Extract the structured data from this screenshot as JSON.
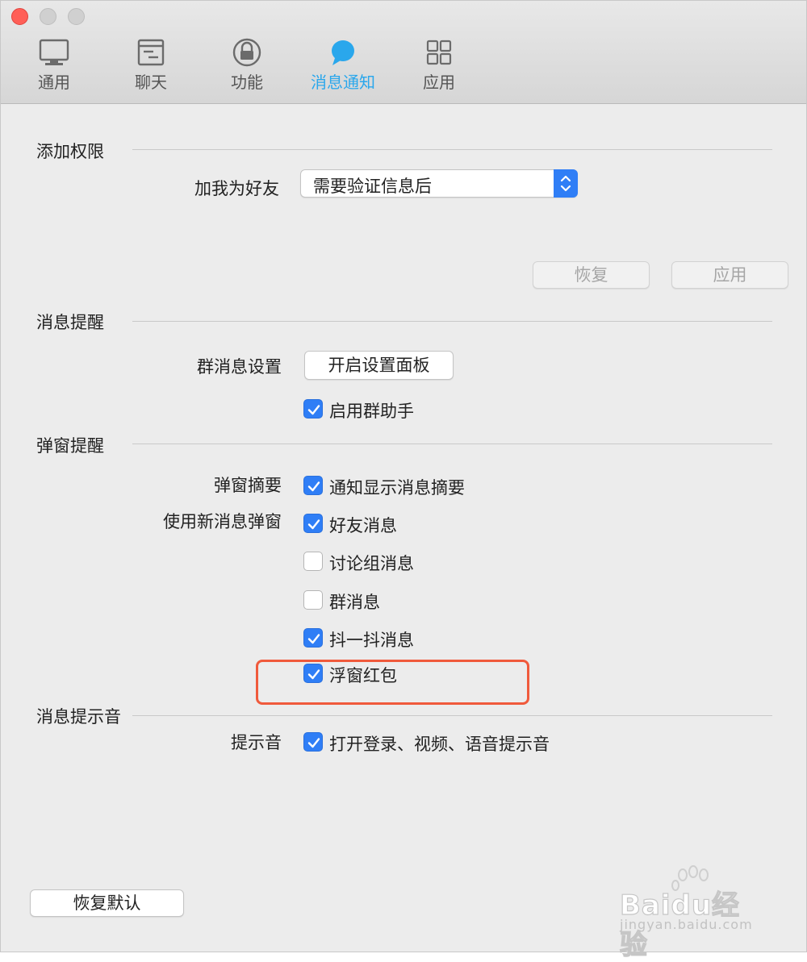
{
  "tabs": [
    {
      "label": "通用",
      "icon": "monitor-icon",
      "active": false
    },
    {
      "label": "聊天",
      "icon": "chat-window-icon",
      "active": false
    },
    {
      "label": "功能",
      "icon": "lock-icon",
      "active": false
    },
    {
      "label": "消息通知",
      "icon": "speech-bubble-icon",
      "active": true
    },
    {
      "label": "应用",
      "icon": "grid-icon",
      "active": false
    }
  ],
  "permissions": {
    "title": "添加权限",
    "add_friend_label": "加我为好友",
    "add_friend_value": "需要验证信息后",
    "restore_button": "恢复",
    "apply_button": "应用"
  },
  "reminder": {
    "title": "消息提醒",
    "group_settings_label": "群消息设置",
    "open_panel_button": "开启设置面板",
    "enable_group_helper": {
      "label": "启用群助手",
      "checked": true
    }
  },
  "popup": {
    "title": "弹窗提醒",
    "summary_label": "弹窗摘要",
    "summary_option": {
      "label": "通知显示消息摘要",
      "checked": true
    },
    "new_popup_label": "使用新消息弹窗",
    "options": [
      {
        "label": "好友消息",
        "checked": true
      },
      {
        "label": "讨论组消息",
        "checked": false
      },
      {
        "label": "群消息",
        "checked": false
      },
      {
        "label": "抖一抖消息",
        "checked": true
      },
      {
        "label": "浮窗红包",
        "checked": true
      }
    ]
  },
  "sound": {
    "title": "消息提示音",
    "tone_label": "提示音",
    "tone_option": {
      "label": "打开登录、视频、语音提示音",
      "checked": true
    }
  },
  "footer": {
    "restore_default_button": "恢复默认"
  },
  "watermark": {
    "brand": "Baidu经验",
    "url": "jingyan.baidu.com"
  },
  "colors": {
    "accent": "#2aa7ec",
    "checkbox": "#2f7ef6",
    "highlight": "#f05a3c",
    "close": "#ff5f57"
  }
}
